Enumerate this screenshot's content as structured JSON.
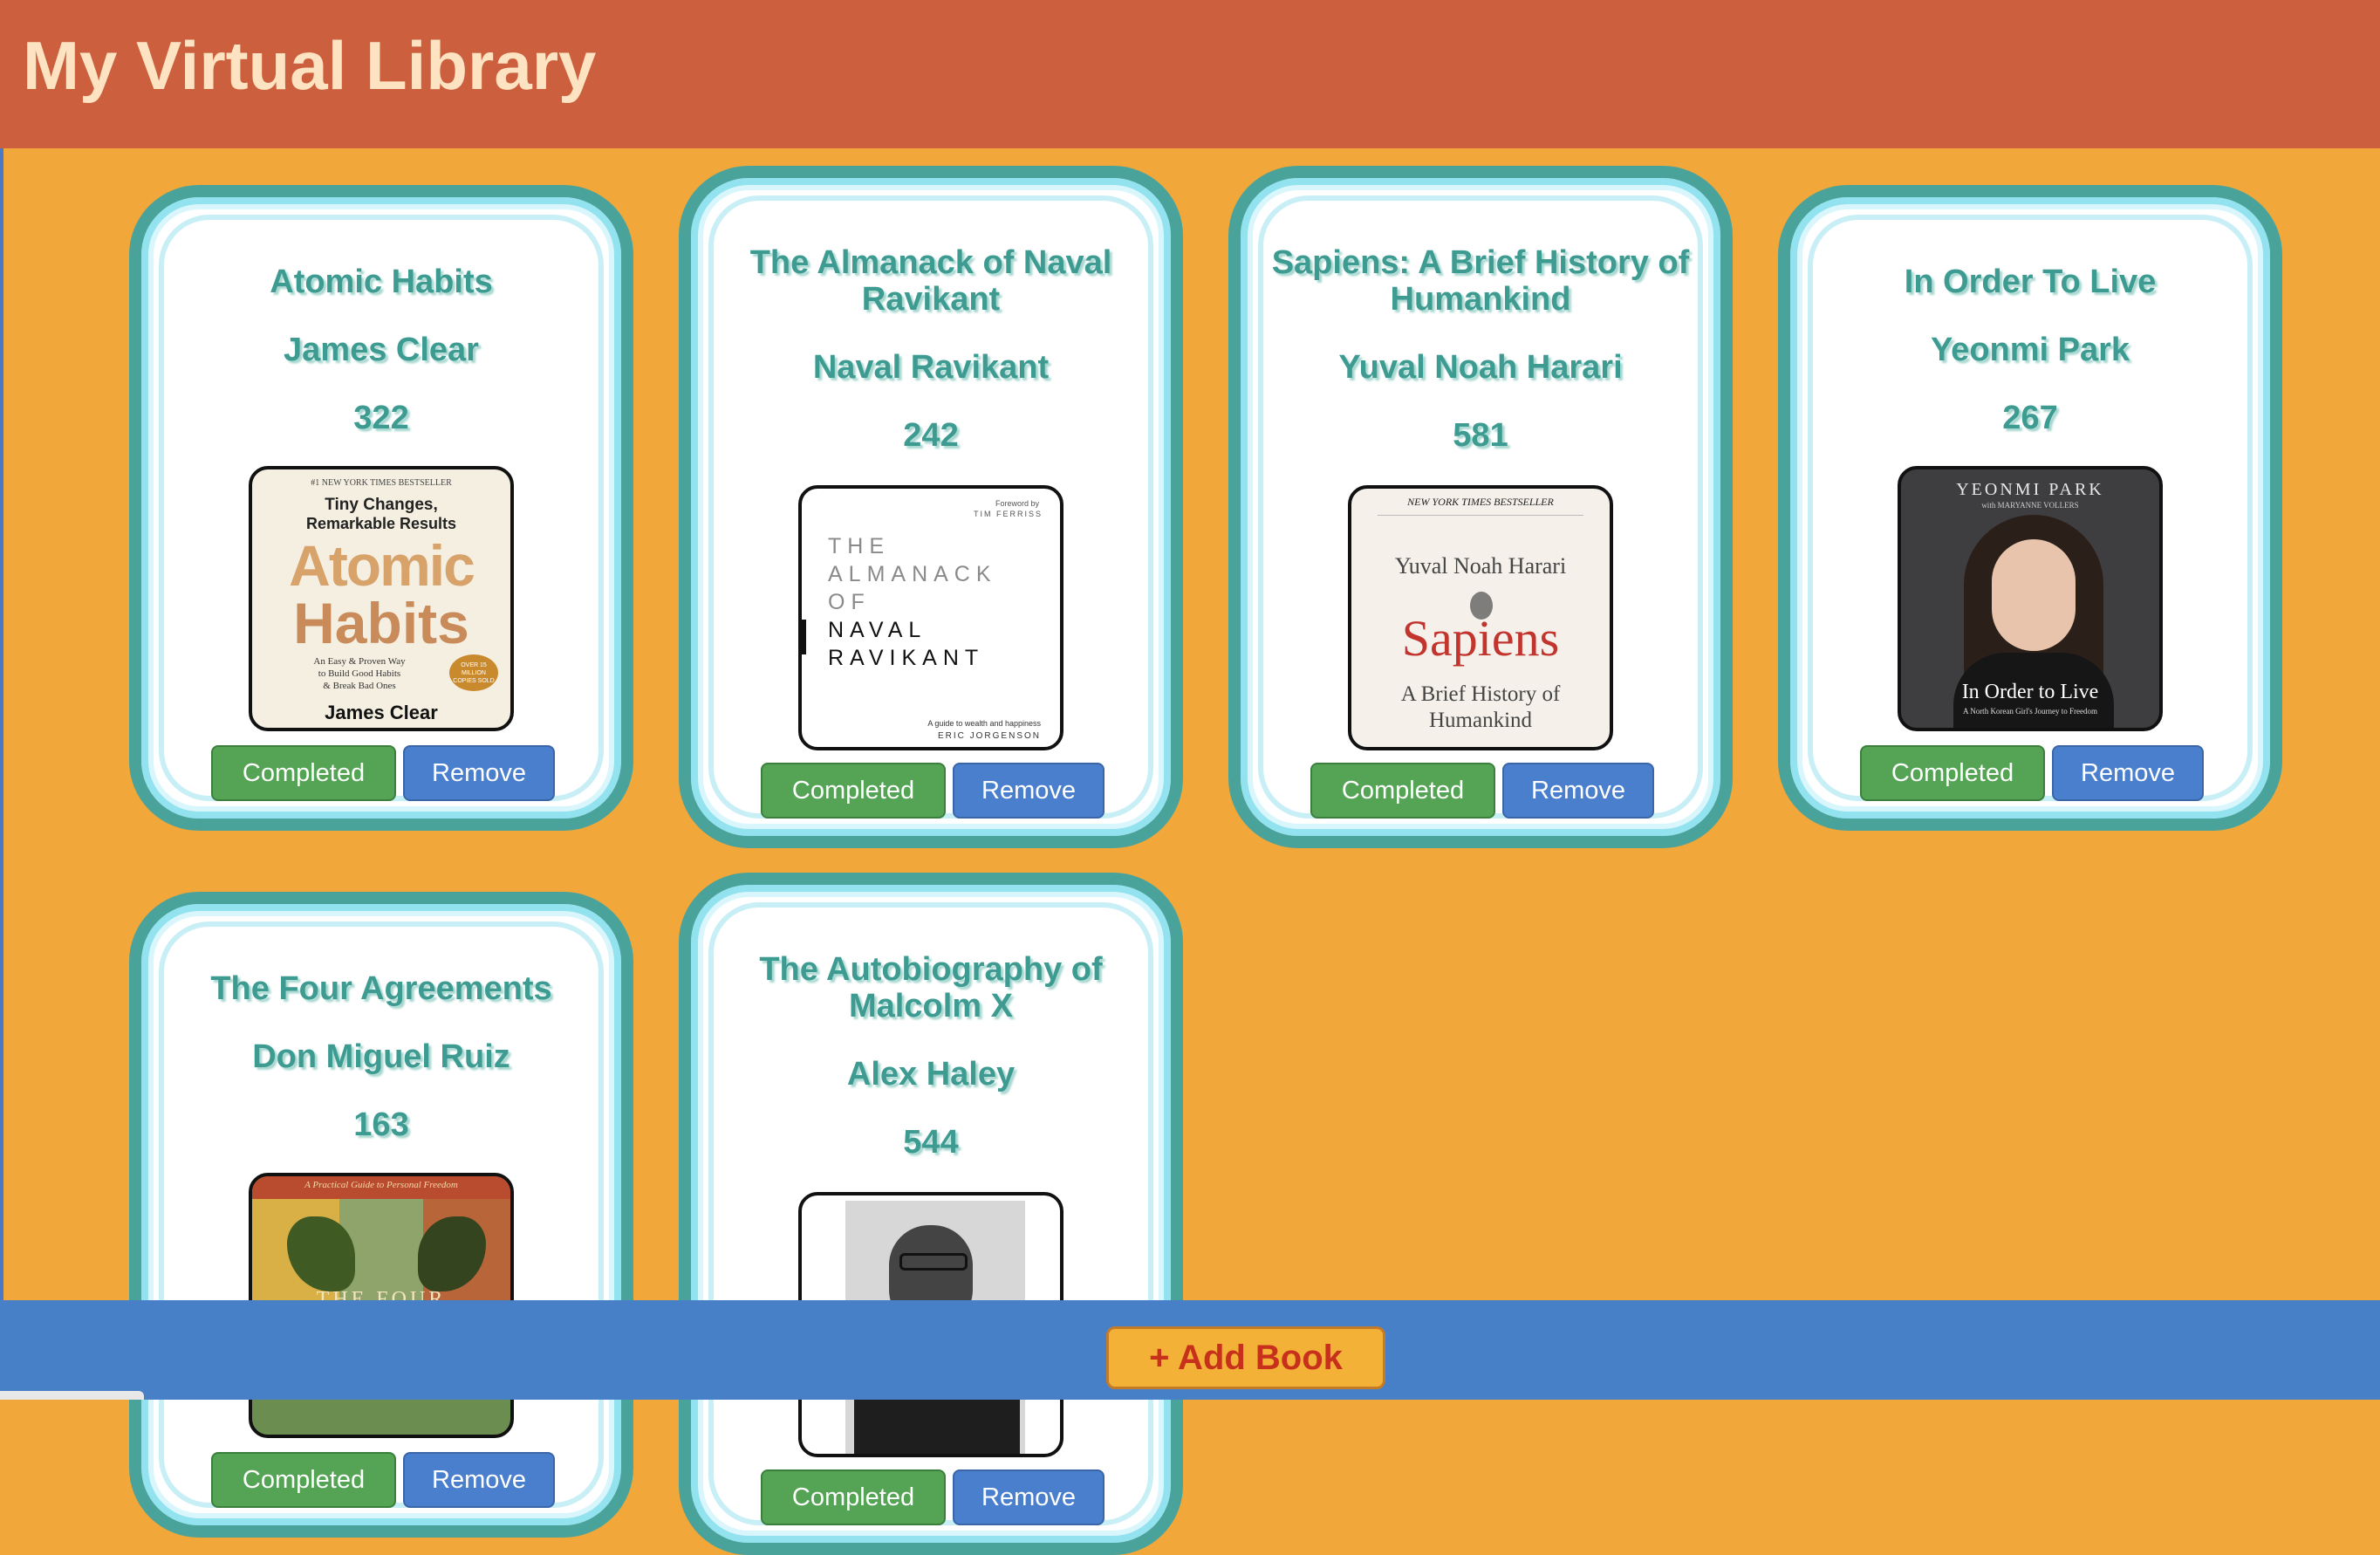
{
  "app": {
    "title": "My Virtual Library"
  },
  "actions": {
    "completed_label": "Completed",
    "remove_label": "Remove",
    "add_book_label": "+ Add Book"
  },
  "books": [
    {
      "title": "Atomic Habits",
      "author": "James Clear",
      "pages": "322",
      "cover": {
        "kicker": "#1 NEW YORK TIMES BESTSELLER",
        "tagline1": "Tiny Changes,",
        "tagline2": "Remarkable Results",
        "word1": "Atomic",
        "word2": "Habits",
        "sub1": "An Easy & Proven Way",
        "sub2": "to Build Good Habits",
        "sub3": "& Break Bad Ones",
        "badge": "OVER 15 MILLION COPIES SOLD",
        "author": "James Clear"
      }
    },
    {
      "title": "The Almanack of Naval Ravikant",
      "author": "Naval Ravikant",
      "pages": "242",
      "cover": {
        "foreword1": "Foreword by",
        "foreword2": "TIM FERRISS",
        "line1": "THE",
        "line2": "ALMANACK",
        "line3": "OF",
        "line4": "NAVAL",
        "line5": "RAVIKANT",
        "sub": "A guide to wealth and happiness",
        "author": "ERIC JORGENSON"
      }
    },
    {
      "title": "Sapiens: A Brief History of Humankind",
      "author": "Yuval Noah Harari",
      "pages": "581",
      "cover": {
        "kicker": "NEW YORK TIMES BESTSELLER",
        "author": "Yuval Noah Harari",
        "word": "Sapiens",
        "sub1": "A Brief History of",
        "sub2": "Humankind"
      }
    },
    {
      "title": "In Order To Live",
      "author": "Yeonmi Park",
      "pages": "267",
      "cover": {
        "author": "YEONMI PARK",
        "with": "with MARYANNE VOLLERS",
        "title": "In Order to Live",
        "sub": "A North Korean Girl's Journey to Freedom"
      }
    },
    {
      "title": "The Four Agreements",
      "author": "Don Miguel Ruiz",
      "pages": "163",
      "cover": {
        "kicker": "A Practical Guide to Personal Freedom",
        "word": "THE FOUR"
      }
    },
    {
      "title": "The Autobiography of Malcolm X",
      "author": "Alex Haley",
      "pages": "544",
      "cover": {}
    }
  ]
}
